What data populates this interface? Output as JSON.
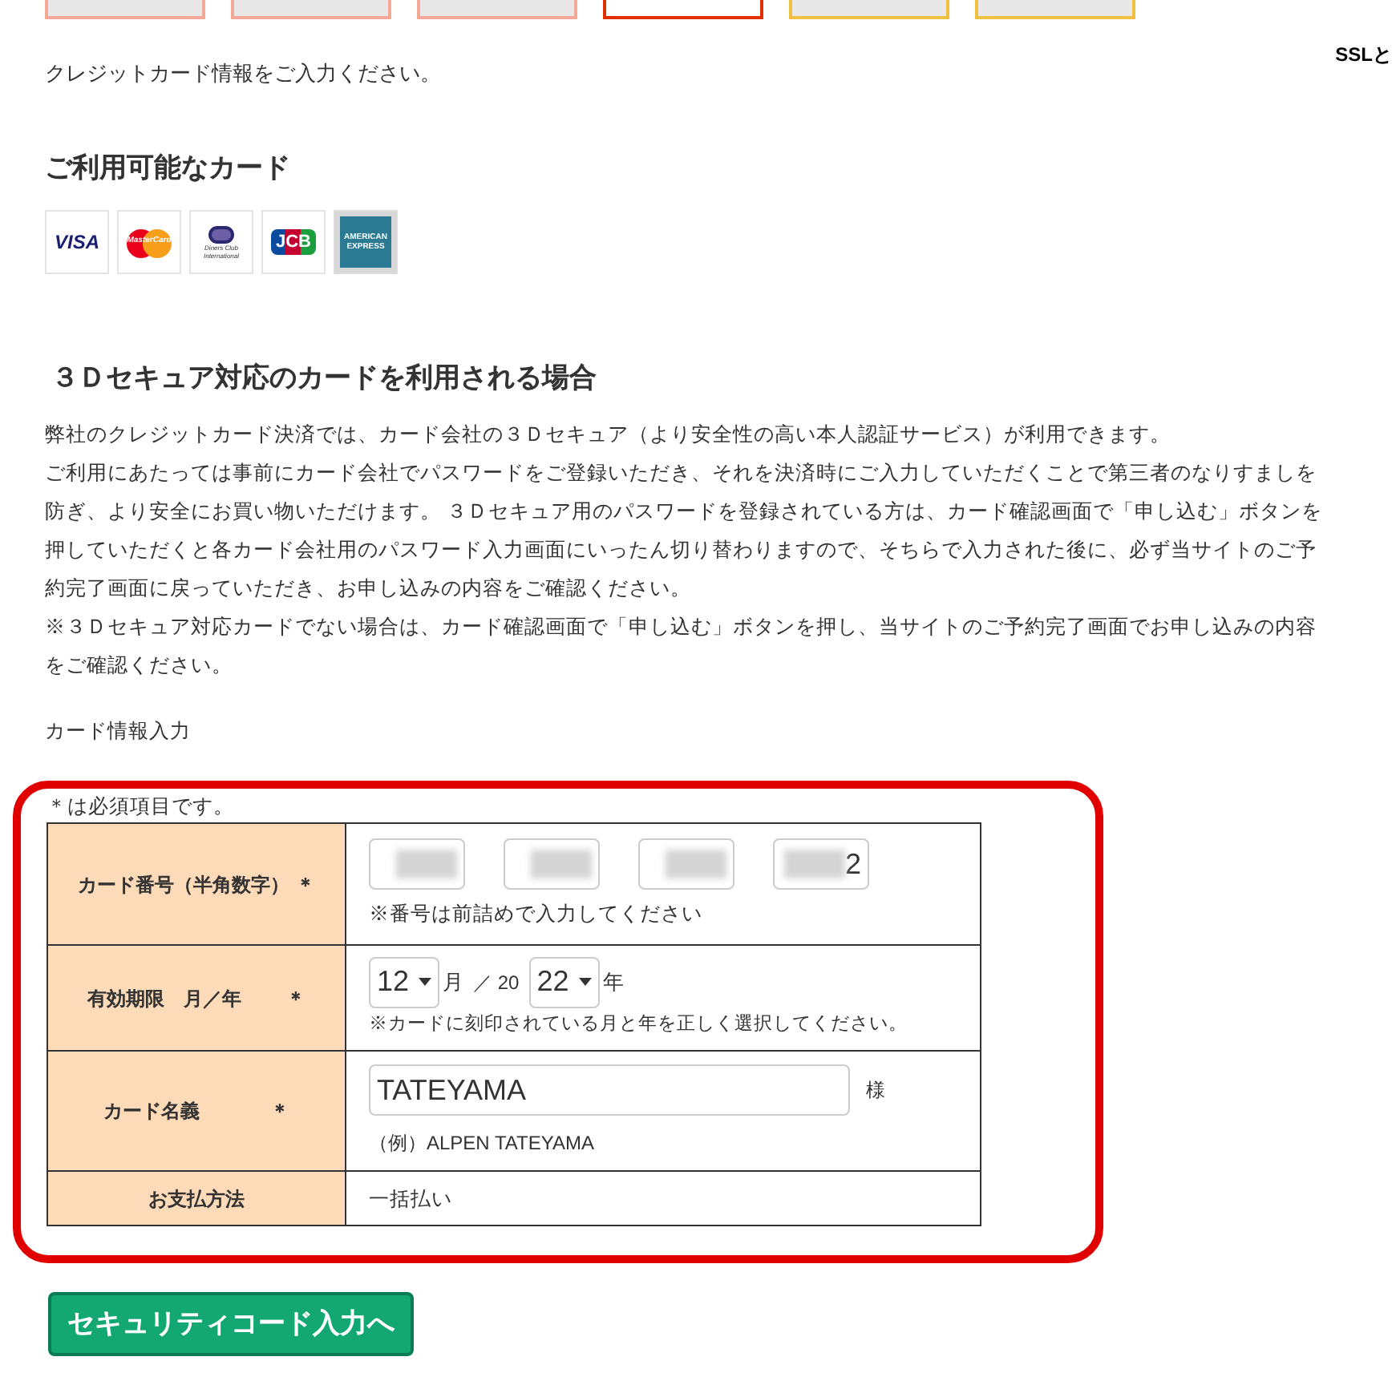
{
  "steps": [
    {
      "selected": false,
      "color": "#f4a898"
    },
    {
      "selected": false,
      "color": "#f4a898"
    },
    {
      "selected": false,
      "color": "#f4a898"
    },
    {
      "selected": true,
      "color": "#e03000"
    },
    {
      "selected": false,
      "color": "#f0c040"
    },
    {
      "selected": false,
      "color": "#f0c040"
    }
  ],
  "ssl_note": "SSLと",
  "intro": "クレジットカード情報をご入力ください。",
  "cards_heading": "ご利用可能なカード",
  "cards": [
    {
      "kind": "visa",
      "label": "VISA"
    },
    {
      "kind": "mastercard",
      "label": "MasterCard"
    },
    {
      "kind": "diners",
      "label": "Diners Club International"
    },
    {
      "kind": "jcb",
      "label": "JCB"
    },
    {
      "kind": "amex",
      "label": "AMERICAN EXPRESS"
    }
  ],
  "secure_heading": "３Ｄセキュア対応のカードを利用される場合",
  "secure_paragraphs": [
    "弊社のクレジットカード決済では、カード会社の３Ｄセキュア（より安全性の高い本人認証サービス）が利用できます。",
    "ご利用にあたっては事前にカード会社でパスワードをご登録いただき、それを決済時にご入力していただくことで第三者のなりすましを防ぎ、より安全にお買い物いただけます。 ３Ｄセキュア用のパスワードを登録されている方は、カード確認画面で「申し込む」ボタンを押していただくと各カード会社用のパスワード入力画面にいったん切り替わりますので、そちらで入力された後に、必ず当サイトのご予約完了画面に戻っていただき、お申し込みの内容をご確認ください。",
    "※３Ｄセキュア対応カードでない場合は、カード確認画面で「申し込む」ボタンを押し、当サイトのご予約完了画面でお申し込みの内容をご確認ください。"
  ],
  "card_info_label": "カード情報入力",
  "form": {
    "required_note": "＊は必須項目です。",
    "card_number": {
      "label": "カード番号（半角数字）",
      "required_mark": "＊",
      "fields": [
        {
          "blurred": true
        },
        {
          "blurred": true
        },
        {
          "blurred": true
        },
        {
          "blurred": true,
          "value": "2"
        }
      ],
      "hint": "※番号は前詰めで入力してください"
    },
    "expiry": {
      "label": "有効期限　月／年",
      "required_mark": "＊",
      "month": "12",
      "month_unit": "月",
      "separator": "／ 20",
      "year": "22",
      "year_unit": "年",
      "hint": "※カードに刻印されている月と年を正しく選択してください。"
    },
    "holder": {
      "label": "カード名義",
      "required_mark": "＊",
      "value": "TATEYAMA",
      "suffix": "様",
      "example": "（例）ALPEN TATEYAMA"
    },
    "payment": {
      "label": "お支払方法",
      "value": "一括払い"
    }
  },
  "submit_button": "セキュリティコード入力へ"
}
